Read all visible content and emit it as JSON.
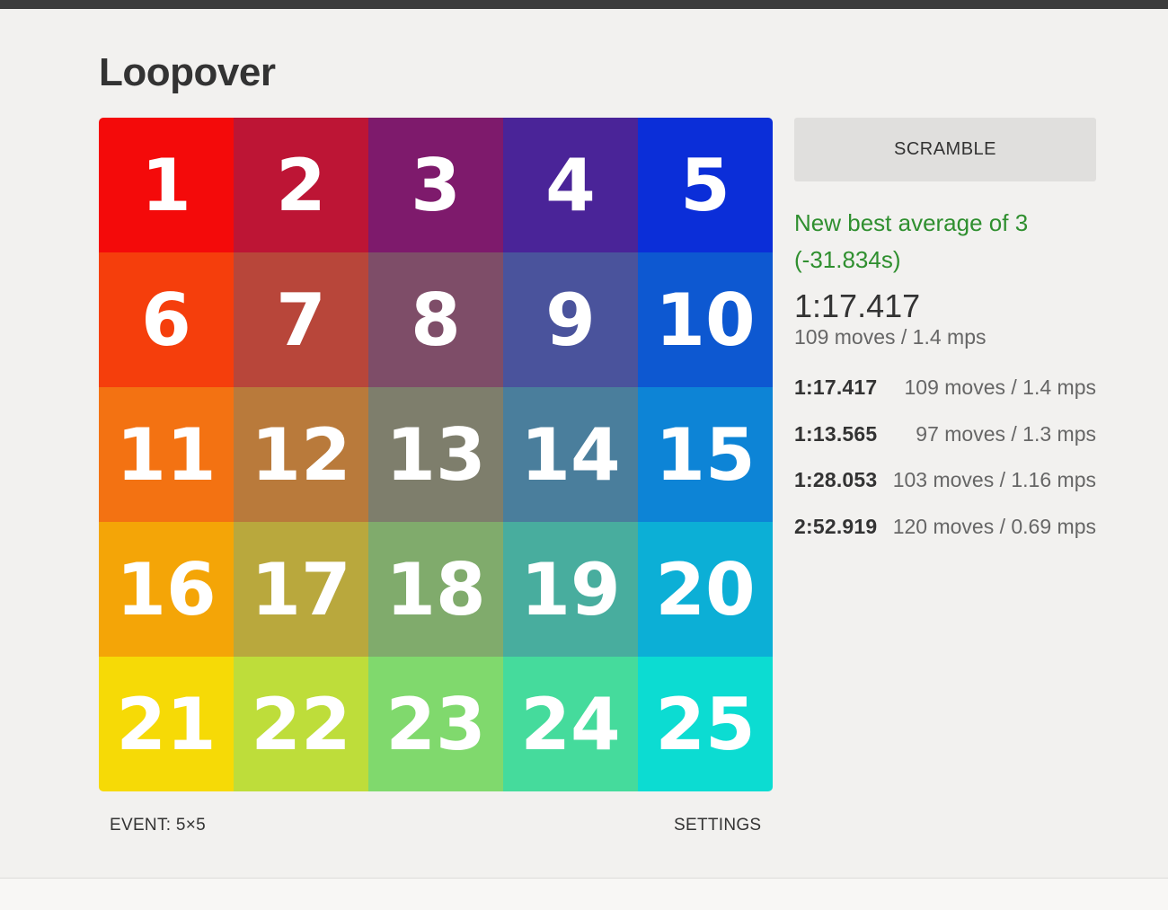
{
  "title": "Loopover",
  "scramble_label": "SCRAMBLE",
  "notice": "New best average of 3 (-31.834s)",
  "current": {
    "time": "1:17.417",
    "stats": "109 moves / 1.4 mps"
  },
  "history": [
    {
      "time": "1:17.417",
      "stats": "109 moves / 1.4 mps"
    },
    {
      "time": "1:13.565",
      "stats": "97 moves / 1.3 mps"
    },
    {
      "time": "1:28.053",
      "stats": "103 moves / 1.16 mps"
    },
    {
      "time": "2:52.919",
      "stats": "120 moves / 0.69 mps"
    }
  ],
  "event_label": "EVENT: 5×5",
  "settings_label": "SETTINGS",
  "board": {
    "size": 5,
    "tiles": [
      {
        "label": "1",
        "color": "#f40a0a"
      },
      {
        "label": "2",
        "color": "#bd1535"
      },
      {
        "label": "3",
        "color": "#7e1a6c"
      },
      {
        "label": "4",
        "color": "#4a2498"
      },
      {
        "label": "5",
        "color": "#0b2ed8"
      },
      {
        "label": "6",
        "color": "#f53e0c"
      },
      {
        "label": "7",
        "color": "#b8463a"
      },
      {
        "label": "8",
        "color": "#7e4d68"
      },
      {
        "label": "9",
        "color": "#4a539c"
      },
      {
        "label": "10",
        "color": "#0d58d1"
      },
      {
        "label": "11",
        "color": "#f37212"
      },
      {
        "label": "12",
        "color": "#b97a3b"
      },
      {
        "label": "13",
        "color": "#7e7e6c"
      },
      {
        "label": "14",
        "color": "#4a7e9c"
      },
      {
        "label": "15",
        "color": "#0d84d6"
      },
      {
        "label": "16",
        "color": "#f4a507"
      },
      {
        "label": "17",
        "color": "#b9a83d"
      },
      {
        "label": "18",
        "color": "#80ab6c"
      },
      {
        "label": "19",
        "color": "#48ad9e"
      },
      {
        "label": "20",
        "color": "#0cafd6"
      },
      {
        "label": "21",
        "color": "#f6da06"
      },
      {
        "label": "22",
        "color": "#bedd3a"
      },
      {
        "label": "23",
        "color": "#80d96d"
      },
      {
        "label": "24",
        "color": "#45db9c"
      },
      {
        "label": "25",
        "color": "#0cdcd2"
      }
    ]
  }
}
